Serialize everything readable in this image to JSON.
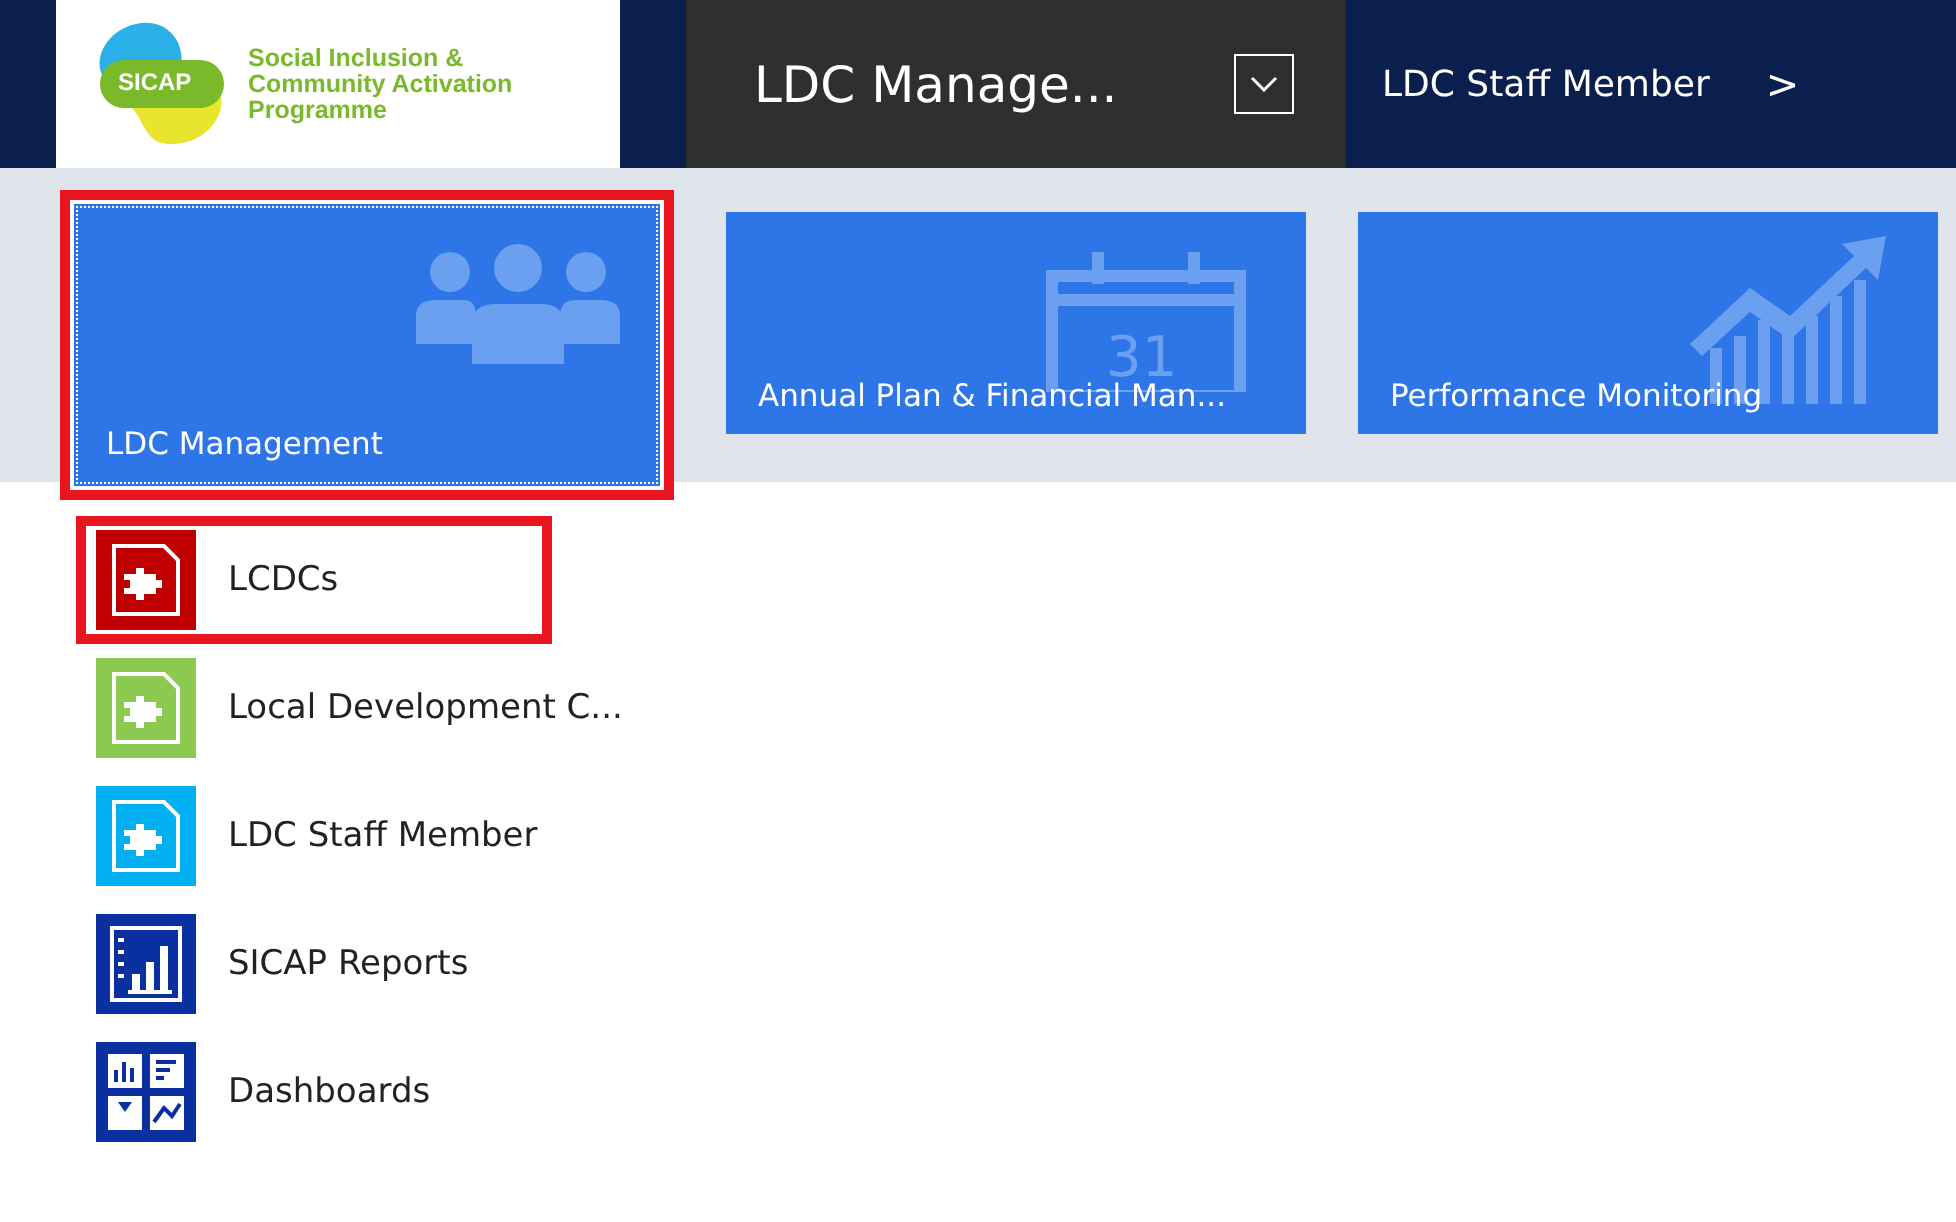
{
  "logo": {
    "mark": "SICAP",
    "lines": [
      "Social Inclusion &",
      "Community Activation",
      "Programme"
    ]
  },
  "nav": {
    "area": "LDC Manage...",
    "breadcrumb": "LDC Staff Member",
    "chevron": ">"
  },
  "tiles": [
    {
      "label": "LDC Management",
      "kind": "people",
      "selected": true
    },
    {
      "label": "Annual Plan & Financial Man...",
      "kind": "calendar",
      "calendar_day": "31",
      "selected": false
    },
    {
      "label": "Performance Monitoring",
      "kind": "chart",
      "selected": false
    }
  ],
  "items": [
    {
      "label": "LCDCs",
      "kind": "puzzle",
      "color": "#c00000",
      "selected": true
    },
    {
      "label": "Local Development C...",
      "kind": "puzzle",
      "color": "#8cc950",
      "selected": false
    },
    {
      "label": "LDC Staff Member",
      "kind": "puzzle",
      "color": "#00b0f0",
      "selected": false
    },
    {
      "label": "SICAP Reports",
      "kind": "report",
      "color": "#0a2f9f",
      "selected": false
    },
    {
      "label": "Dashboards",
      "kind": "dashboard",
      "color": "#0a2f9f",
      "selected": false
    }
  ]
}
